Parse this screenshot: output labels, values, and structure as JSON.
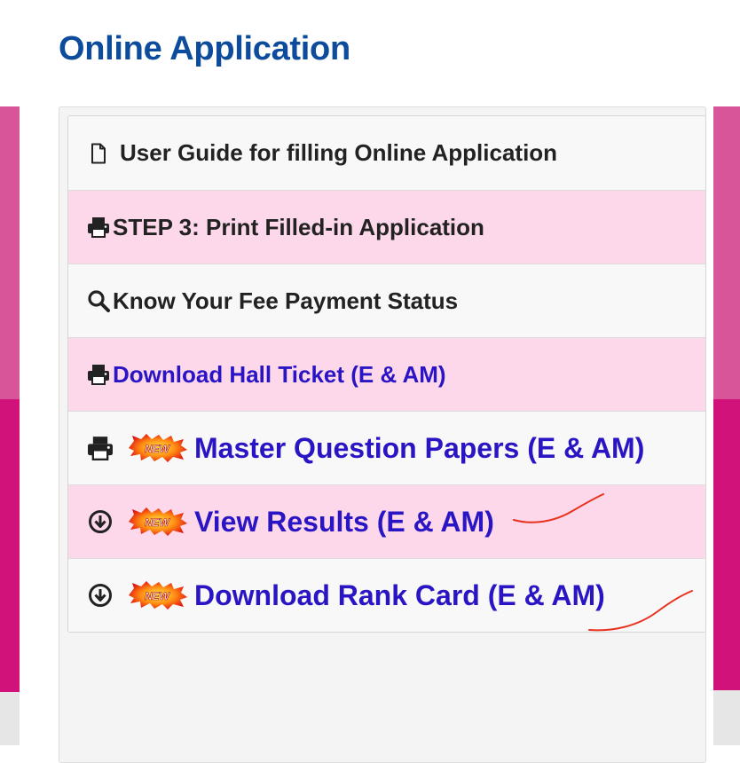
{
  "page": {
    "title": "Online Application"
  },
  "badge": {
    "new_text": "NEW"
  },
  "items": [
    {
      "label": "User Guide for filling Online Application",
      "icon": "file-icon",
      "style": "white"
    },
    {
      "label": "STEP 3: Print Filled-in Application",
      "icon": "print-icon",
      "style": "pink"
    },
    {
      "label": "Know Your Fee Payment Status",
      "icon": "search-icon",
      "style": "white"
    },
    {
      "label": "Download Hall Ticket (E & AM)",
      "icon": "print-icon",
      "style": "pink"
    },
    {
      "label": "Master Question Papers (E & AM)",
      "icon": "print-icon",
      "style": "white",
      "badge": "NEW"
    },
    {
      "label": "View Results (E & AM)",
      "icon": "download-circle-icon",
      "style": "pink",
      "badge": "NEW"
    },
    {
      "label": "Download Rank Card (E & AM)",
      "icon": "download-circle-icon",
      "style": "white",
      "badge": "NEW"
    }
  ],
  "colors": {
    "title": "#0d4c9c",
    "link_blue": "#2a15c4",
    "pink_row": "#fdd8ea",
    "side_pink": "#d9559a",
    "side_magenta": "#d0127a",
    "annotation_red": "#e8321e"
  }
}
